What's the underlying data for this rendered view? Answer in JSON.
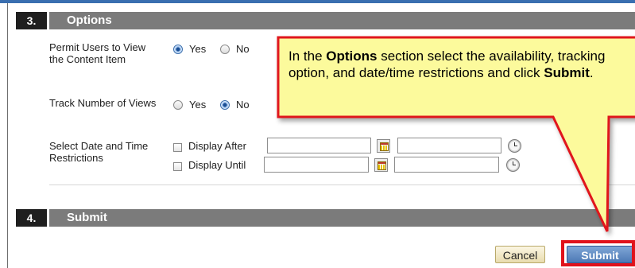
{
  "sections": {
    "options": {
      "number": "3.",
      "title": "Options"
    },
    "submit": {
      "number": "4.",
      "title": "Submit"
    }
  },
  "permit_users": {
    "label": "Permit Users to View the Content Item",
    "yes_label": "Yes",
    "no_label": "No",
    "selected": "Yes"
  },
  "track_views": {
    "label": "Track Number of Views",
    "yes_label": "Yes",
    "no_label": "No",
    "selected": "No"
  },
  "date_restrictions": {
    "label": "Select Date and Time Restrictions",
    "display_after_label": "Display After",
    "display_until_label": "Display Until",
    "display_after_date": "",
    "display_after_time": "",
    "display_until_date": "",
    "display_until_time": ""
  },
  "callout": {
    "part1": "In the ",
    "bold1": "Options",
    "part2": " section select the availability, tracking option, and date/time restrictions and click ",
    "bold2": "Submit",
    "part3": ".",
    "fill_color": "#fcfa9c",
    "border_color": "#e0121b"
  },
  "buttons": {
    "cancel_label": "Cancel",
    "submit_label": "Submit"
  },
  "colors": {
    "section_header": "#7b7b7b",
    "section_number": "#1f1f1f",
    "highlight": "#e0121b",
    "submit_button": "#4d79b5",
    "top_rule": "#3a6fb0"
  }
}
